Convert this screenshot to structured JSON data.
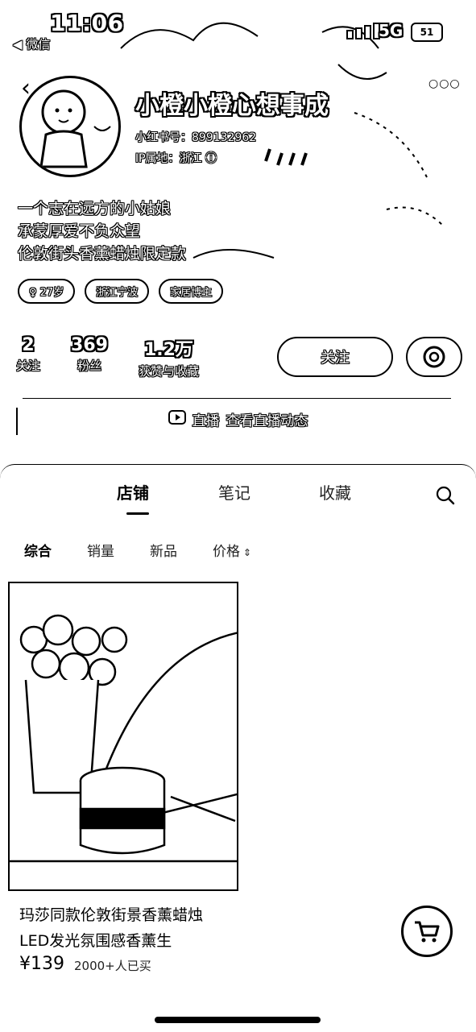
{
  "status": {
    "time": "11:06",
    "back_app": "微信",
    "network": "5G",
    "battery": "51"
  },
  "profile": {
    "nickname": "小橙小橙心想事成",
    "redid_label": "小红书号：",
    "redid_value": "899132962",
    "ip_label": "IP属地：",
    "ip_value": "浙江",
    "bio_lines": [
      "一个志在远方的小姑娘",
      "承蒙厚爱不负众望",
      "伦敦街头香薰蜡烛限定款"
    ],
    "tags": [
      "♀ 27岁",
      "浙江宁波",
      "家居博主"
    ],
    "stats": [
      {
        "value": "2",
        "label": "关注"
      },
      {
        "value": "369",
        "label": "粉丝"
      },
      {
        "value": "1.2万",
        "label": "获赞与收藏"
      }
    ],
    "follow_label": "关注",
    "live_label": "直播",
    "live_text": "查看直播动态"
  },
  "tabs": {
    "items": [
      "店铺",
      "笔记",
      "收藏"
    ],
    "active": "店铺"
  },
  "filters": {
    "items": [
      "综合",
      "销量",
      "新品",
      "价格"
    ],
    "active": "综合"
  },
  "product": {
    "title": "玛莎同款伦敦街景香薰蜡烛LED发光氛围感香薰生",
    "price": "¥139",
    "sold": "2000+人已买"
  }
}
